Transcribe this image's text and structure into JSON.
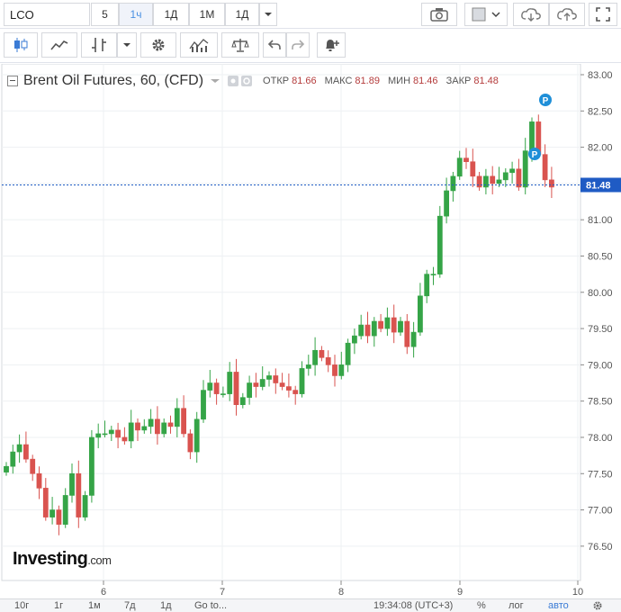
{
  "toolbar": {
    "symbol": "LCO",
    "intervals": [
      "5",
      "1ч",
      "1Д",
      "1М",
      "1Д"
    ],
    "active_interval": "1ч"
  },
  "legend": {
    "title": "Brent Oil Futures, 60, (CFD)",
    "open_label": "ОТКР",
    "open": "81.66",
    "high_label": "МАКС",
    "high": "81.89",
    "low_label": "МИН",
    "low": "81.46",
    "close_label": "ЗАКР",
    "close": "81.48"
  },
  "logo": {
    "main": "Investing",
    "suffix": ".com"
  },
  "bottom_bar": {
    "ranges": [
      "10г",
      "1г",
      "1м",
      "7д",
      "1д"
    ],
    "goto": "Go to...",
    "time": "19:34:08 (UTC+3)",
    "percent": "%",
    "log": "лог",
    "auto": "авто"
  },
  "colors": {
    "up": "#35a447",
    "down": "#d9534f",
    "last_price": "#1f5bc4",
    "grid": "#eef0f3",
    "axis": "#555555"
  },
  "chart_data": {
    "type": "candlestick",
    "symbol": "Brent Oil Futures",
    "interval": "60",
    "ylim": [
      76.25,
      83.0
    ],
    "yticks": [
      76.5,
      77.0,
      77.5,
      78.0,
      78.5,
      79.0,
      79.5,
      80.0,
      80.5,
      81.0,
      81.5,
      82.0,
      82.5,
      83.0
    ],
    "xticks": [
      "6",
      "7",
      "8",
      "9",
      "10"
    ],
    "last_price": "81.48",
    "close_series": [
      77.6,
      77.8,
      77.9,
      77.7,
      77.5,
      77.3,
      76.9,
      77.0,
      76.8,
      77.2,
      77.5,
      76.9,
      77.2,
      78.0,
      78.05,
      78.05,
      78.1,
      78.0,
      77.95,
      78.2,
      78.1,
      78.15,
      78.25,
      78.05,
      78.2,
      78.15,
      78.4,
      78.05,
      77.8,
      78.25,
      78.65,
      78.75,
      78.6,
      78.6,
      78.9,
      78.45,
      78.55,
      78.75,
      78.7,
      78.8,
      78.85,
      78.75,
      78.7,
      78.65,
      78.6,
      78.95,
      79.0,
      79.2,
      79.1,
      79.0,
      78.85,
      79.0,
      79.3,
      79.4,
      79.55,
      79.4,
      79.6,
      79.5,
      79.65,
      79.45,
      79.6,
      79.25,
      79.45,
      79.95,
      80.25,
      80.25,
      81.05,
      81.4,
      81.6,
      81.85,
      81.8,
      81.6,
      81.45,
      81.6,
      81.5,
      81.55,
      81.65,
      81.7,
      81.45,
      81.95,
      82.35,
      81.9,
      81.55,
      81.45
    ]
  }
}
